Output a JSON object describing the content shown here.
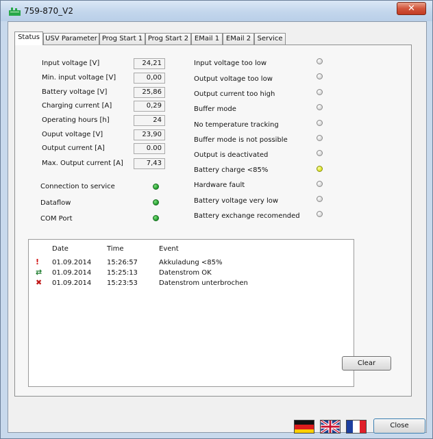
{
  "window": {
    "title": "759-870_V2",
    "close_glyph": "✕"
  },
  "tabs": [
    {
      "label": "Status",
      "active": true
    },
    {
      "label": "USV Parameter"
    },
    {
      "label": "Prog Start 1"
    },
    {
      "label": "Prog Start 2"
    },
    {
      "label": "EMail 1"
    },
    {
      "label": "EMail 2"
    },
    {
      "label": "Service"
    }
  ],
  "measurements": [
    {
      "label": "Input voltage [V]",
      "value": "24,21"
    },
    {
      "label": "Min. input voltage [V]",
      "value": "0,00"
    },
    {
      "label": "Battery voltage [V]",
      "value": "25,86"
    },
    {
      "label": "Charging current [A]",
      "value": "0,29"
    },
    {
      "label": "Operating hours [h]",
      "value": "24"
    },
    {
      "label": "Ouput voltage [V]",
      "value": "23,90"
    },
    {
      "label": "Output current [A]",
      "value": "0.00"
    },
    {
      "label": "Max. Output current [A]",
      "value": "7,43"
    }
  ],
  "connection": [
    {
      "label": "Connection to service",
      "state": "green"
    },
    {
      "label": "Dataflow",
      "state": "green"
    },
    {
      "label": "COM Port",
      "state": "green"
    }
  ],
  "status_flags": [
    {
      "label": "Input voltage too low",
      "state": "grey"
    },
    {
      "label": "Output voltage too low",
      "state": "grey"
    },
    {
      "label": "Output current too high",
      "state": "grey"
    },
    {
      "label": "Buffer mode",
      "state": "grey"
    },
    {
      "label": "No temperature tracking",
      "state": "grey"
    },
    {
      "label": "Buffer mode is not possible",
      "state": "grey"
    },
    {
      "label": "Output is deactivated",
      "state": "grey"
    },
    {
      "label": "Battery charge <85%",
      "state": "yellow"
    },
    {
      "label": "Hardware fault",
      "state": "grey"
    },
    {
      "label": "Battery voltage very low",
      "state": "grey"
    },
    {
      "label": "Battery exchange recomended",
      "state": "grey"
    }
  ],
  "log": {
    "headers": {
      "date": "Date",
      "time": "Time",
      "event": "Event"
    },
    "rows": [
      {
        "icon": "!",
        "icon_color": "#d01010",
        "date": "01.09.2014",
        "time": "15:26:57",
        "event": "Akkuladung <85%"
      },
      {
        "icon": "⇄",
        "icon_color": "#1a7a2a",
        "date": "01.09.2014",
        "time": "15:25:13",
        "event": "Datenstrom OK"
      },
      {
        "icon": "✖",
        "icon_color": "#c01818",
        "date": "01.09.2014",
        "time": "15:23:53",
        "event": "Datenstrom unterbrochen"
      }
    ]
  },
  "buttons": {
    "clear": "Clear",
    "close": "Close"
  },
  "languages": [
    "German",
    "English",
    "French"
  ]
}
